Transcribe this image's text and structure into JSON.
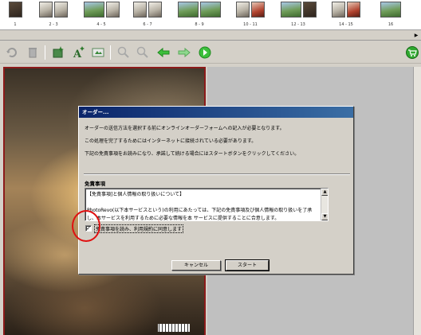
{
  "thumbnails": [
    {
      "label": "1",
      "pics": [
        "dark"
      ]
    },
    {
      "label": "2 - 3",
      "pics": [
        "",
        ""
      ]
    },
    {
      "label": "4 - 5",
      "pics": [
        "land",
        ""
      ]
    },
    {
      "label": "6 - 7",
      "pics": [
        "",
        ""
      ]
    },
    {
      "label": "8 - 9",
      "pics": [
        "land",
        "land"
      ]
    },
    {
      "label": "10 - 11",
      "pics": [
        "",
        "red"
      ]
    },
    {
      "label": "12 - 13",
      "pics": [
        "land",
        "dark"
      ]
    },
    {
      "label": "14 - 15",
      "pics": [
        "",
        "red"
      ]
    },
    {
      "label": "16",
      "pics": [
        "land"
      ]
    }
  ],
  "toolbar": {
    "icons": [
      "undo-icon",
      "trash-icon",
      "add-photo-icon",
      "add-text-icon",
      "frame-icon",
      "zoom-in-icon",
      "zoom-out-icon",
      "arrow-left-icon",
      "arrow-right-icon",
      "play-icon",
      "cart-icon"
    ]
  },
  "dialog": {
    "title": "オーダー...",
    "line1": "オーダーの送信方法を選択する前にオンラインオーダーフォームへの記入が必要となります。",
    "line2": "この処理を完了するためにはインターネットに接続されている必要があります。",
    "line3": "下記の免責事項をお読みになり、承諾して続ける場合にはスタートボタンをクリックしてください。",
    "disclaimer_heading": "免責事項",
    "disclaimer_line1": "【免責事項]と個人情報の取り扱いについて】",
    "disclaimer_line2": "PhotoRevo(以下本サービスという)の利用にあたっては、下記の免責事項及び個人情報の取り扱いを了承",
    "disclaimer_line3": "し、本サービスを利用するために必要な情報を本 サービスに提供することに合意します。",
    "agree_label": "免責事項を読み、利用規約に同意します",
    "agree_checked": "✓",
    "cancel_label": "キャンセル",
    "start_label": "スタート"
  },
  "colors": {
    "titlebar_start": "#0a246a",
    "titlebar_end": "#3a6ea5",
    "highlight_circle": "#e01010",
    "panel_border": "#8c1a1a"
  }
}
